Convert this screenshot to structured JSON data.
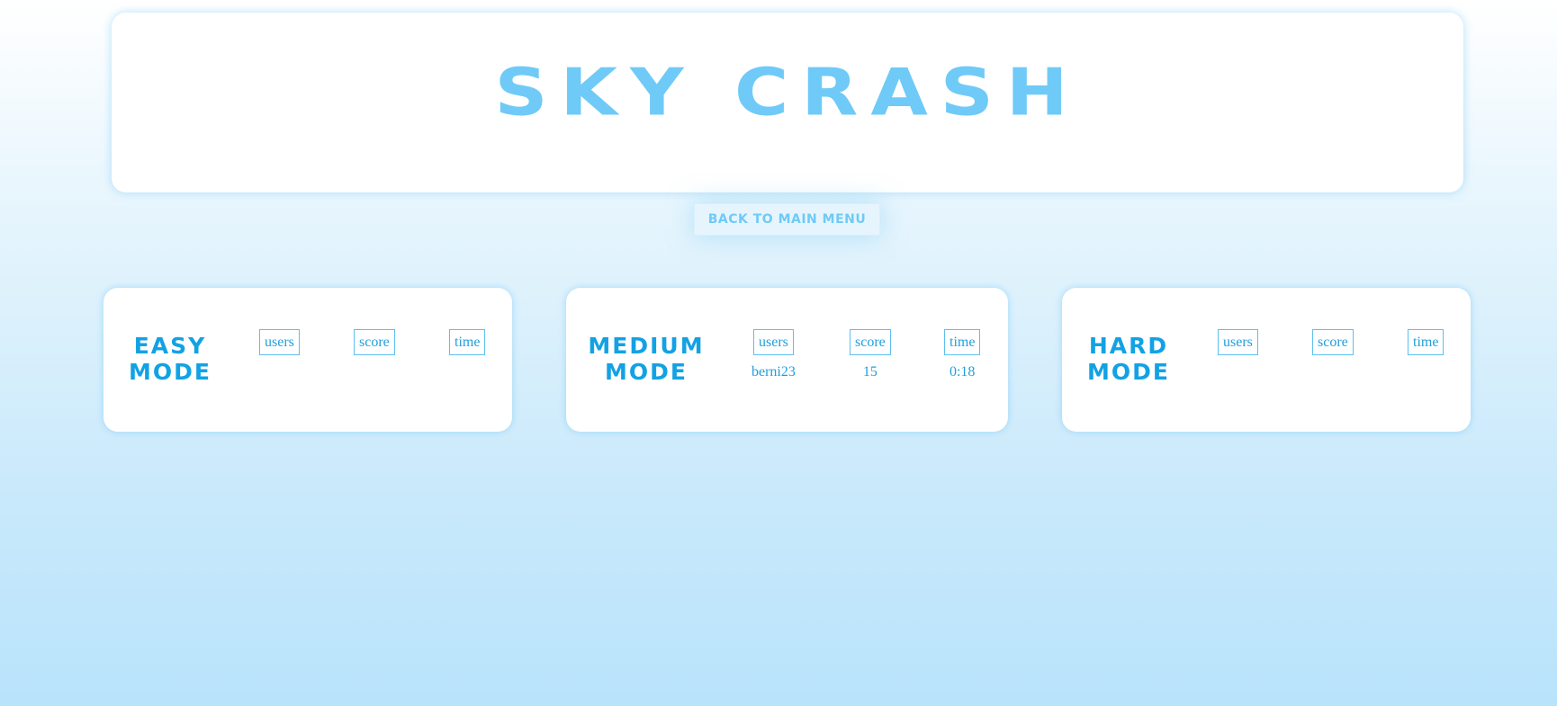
{
  "title": "SKY CRASH",
  "back_button": "BACK TO MAIN MENU",
  "modes": {
    "easy": {
      "name": "EASY MODE",
      "columns": [
        "users",
        "score",
        "time"
      ],
      "entries": []
    },
    "medium": {
      "name": "MEDIUM MODE",
      "columns": [
        "users",
        "score",
        "time"
      ],
      "entries": [
        {
          "user": "berni23",
          "score": "15",
          "time": "0:18"
        }
      ]
    },
    "hard": {
      "name": "HARD MODE",
      "columns": [
        "users",
        "score",
        "time"
      ],
      "entries": []
    }
  },
  "colors": {
    "accent_light": "#6fcaf7",
    "accent_dark": "#12a2e4",
    "table_border": "#5cc0f0"
  }
}
